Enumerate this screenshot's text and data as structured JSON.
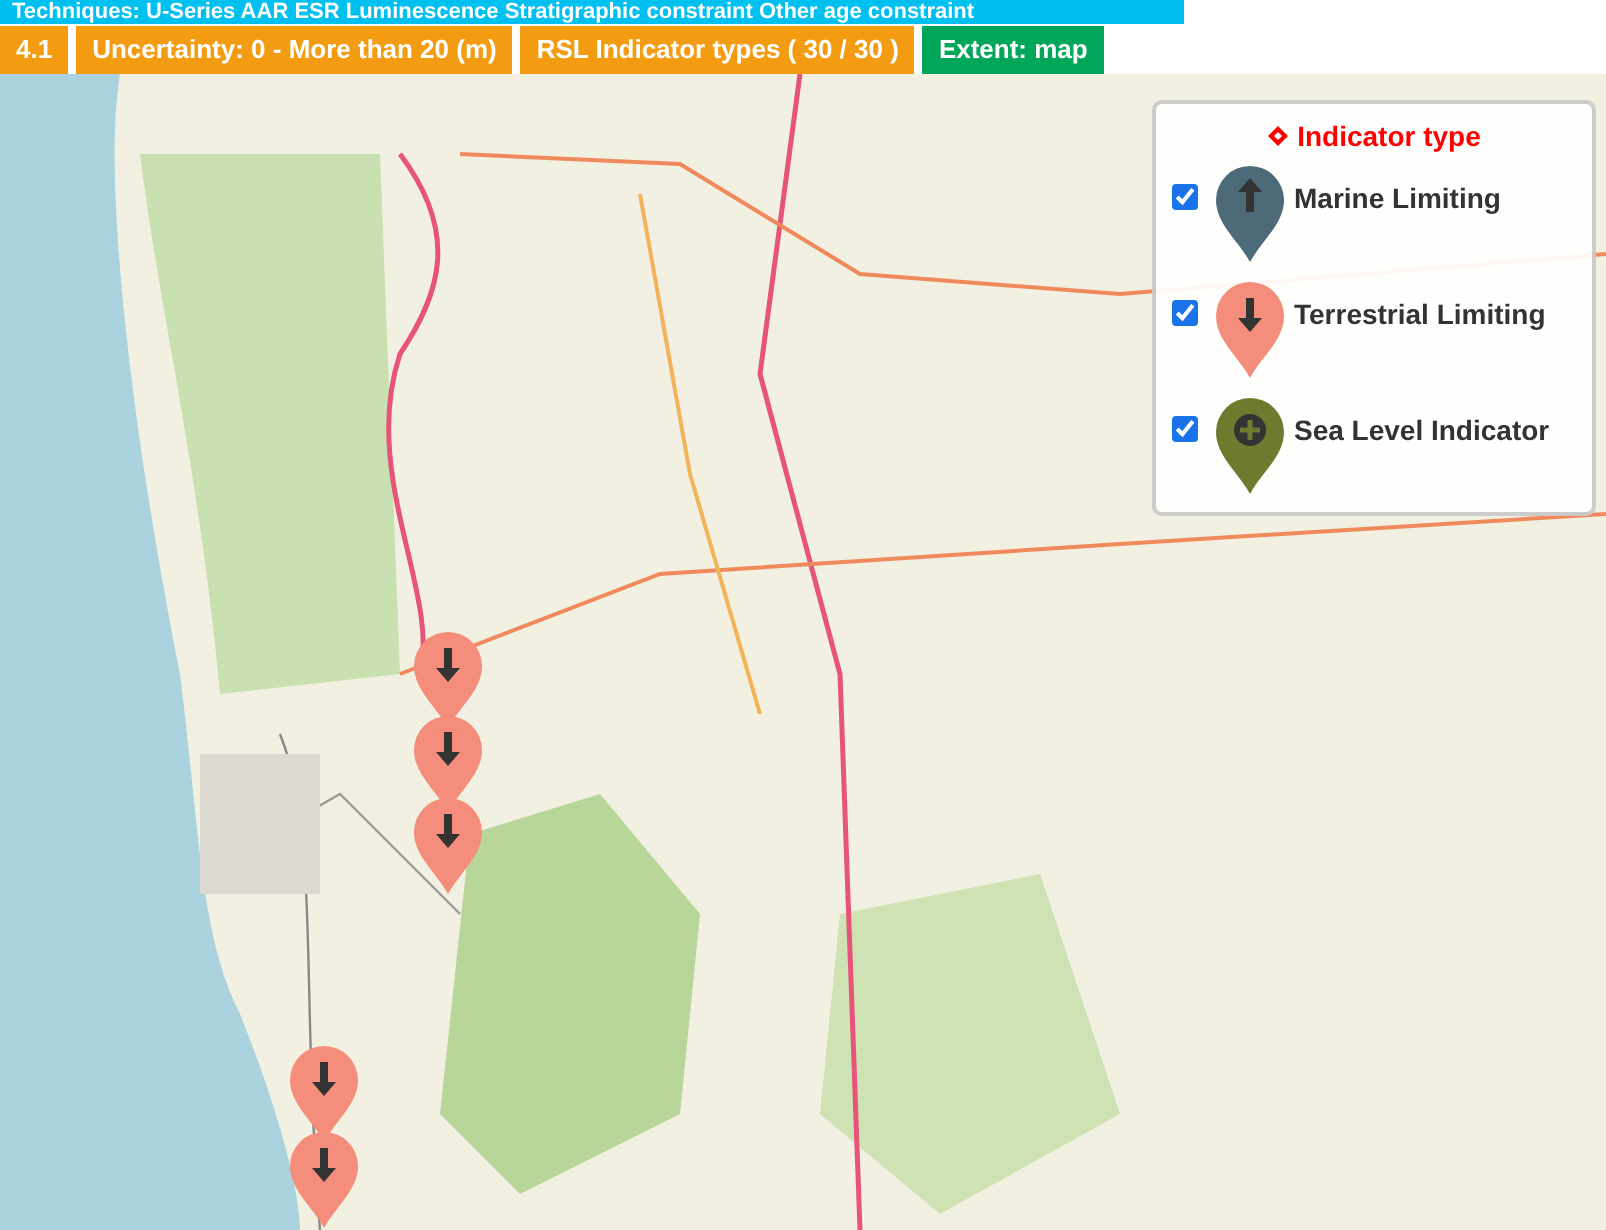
{
  "filter_bar": {
    "text": "Techniques: U-Series AAR ESR Luminescence Stratigraphic constraint Other age constraint"
  },
  "tags": [
    {
      "label": "4.1",
      "kind": "filter"
    },
    {
      "label": "Uncertainty: 0 - More than 20 (m)",
      "kind": "filter"
    },
    {
      "label": "RSL Indicator types ( 30 / 30 )",
      "kind": "filter"
    },
    {
      "label": "Extent: map",
      "kind": "extent"
    }
  ],
  "legend": {
    "title": "Indicator type",
    "items": [
      {
        "label": "Marine Limiting",
        "checked": true,
        "color": "#4d6a78",
        "kind": "up"
      },
      {
        "label": "Terrestrial Limiting",
        "checked": true,
        "color": "#f58d7c",
        "kind": "down"
      },
      {
        "label": "Sea Level Indicator",
        "checked": true,
        "color": "#6e7a2e",
        "kind": "plus"
      }
    ]
  },
  "markers": [
    {
      "kind": "down"
    },
    {
      "kind": "down"
    },
    {
      "kind": "down"
    },
    {
      "kind": "down"
    },
    {
      "kind": "down"
    }
  ]
}
